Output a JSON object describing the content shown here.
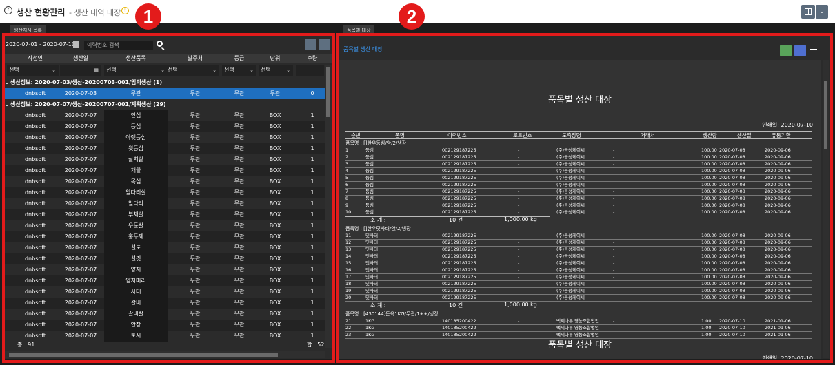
{
  "header": {
    "title": "생산 현황관리",
    "subtitle": "- 생산 내역 대장",
    "back_icon": "back-icon",
    "info_icon": "info-icon"
  },
  "left": {
    "tab": "생산지시 목록",
    "date_range": "2020-07-01 - 2020-07-10",
    "search_placeholder": "이력번호 검색",
    "columns": [
      "작성인",
      "생산일",
      "생산품목",
      "발주처",
      "등급",
      "단위",
      "수량"
    ],
    "filter_select": "선택",
    "groups": [
      {
        "label": "생산정보: 2020-07-03/생산-20200703-001/임의생산 (1)",
        "rows": [
          [
            "dnbsoft",
            "2020-07-03",
            "무관",
            "무관",
            "무관",
            "무관",
            "0"
          ]
        ]
      },
      {
        "label": "생산정보: 2020-07-07/생산-20200707-001/계획생산 (29)",
        "rows": [
          [
            "dnbsoft",
            "2020-07-07",
            "안심",
            "무관",
            "무관",
            "BOX",
            "1"
          ],
          [
            "dnbsoft",
            "2020-07-07",
            "등심",
            "무관",
            "무관",
            "BOX",
            "1"
          ],
          [
            "dnbsoft",
            "2020-07-07",
            "아랫등심",
            "무관",
            "무관",
            "BOX",
            "1"
          ],
          [
            "dnbsoft",
            "2020-07-07",
            "윗등심",
            "무관",
            "무관",
            "BOX",
            "1"
          ],
          [
            "dnbsoft",
            "2020-07-07",
            "살치살",
            "무관",
            "무관",
            "BOX",
            "1"
          ],
          [
            "dnbsoft",
            "2020-07-07",
            "채끝",
            "무관",
            "무관",
            "BOX",
            "1"
          ],
          [
            "dnbsoft",
            "2020-07-07",
            "목심",
            "무관",
            "무관",
            "BOX",
            "1"
          ],
          [
            "dnbsoft",
            "2020-07-07",
            "앞다리살",
            "무관",
            "무관",
            "BOX",
            "1"
          ],
          [
            "dnbsoft",
            "2020-07-07",
            "앞다리",
            "무관",
            "무관",
            "BOX",
            "1"
          ],
          [
            "dnbsoft",
            "2020-07-07",
            "부채살",
            "무관",
            "무관",
            "BOX",
            "1"
          ],
          [
            "dnbsoft",
            "2020-07-07",
            "우둔살",
            "무관",
            "무관",
            "BOX",
            "1"
          ],
          [
            "dnbsoft",
            "2020-07-07",
            "홍두깨",
            "무관",
            "무관",
            "BOX",
            "1"
          ],
          [
            "dnbsoft",
            "2020-07-07",
            "설도",
            "무관",
            "무관",
            "BOX",
            "1"
          ],
          [
            "dnbsoft",
            "2020-07-07",
            "설깃",
            "무관",
            "무관",
            "BOX",
            "1"
          ],
          [
            "dnbsoft",
            "2020-07-07",
            "양지",
            "무관",
            "무관",
            "BOX",
            "1"
          ],
          [
            "dnbsoft",
            "2020-07-07",
            "양지머리",
            "무관",
            "무관",
            "BOX",
            "1"
          ],
          [
            "dnbsoft",
            "2020-07-07",
            "사태",
            "무관",
            "무관",
            "BOX",
            "1"
          ],
          [
            "dnbsoft",
            "2020-07-07",
            "갈비",
            "무관",
            "무관",
            "BOX",
            "1"
          ],
          [
            "dnbsoft",
            "2020-07-07",
            "갈비살",
            "무관",
            "무관",
            "BOX",
            "1"
          ],
          [
            "dnbsoft",
            "2020-07-07",
            "안창",
            "무관",
            "무관",
            "BOX",
            "1"
          ],
          [
            "dnbsoft",
            "2020-07-07",
            "토시",
            "무관",
            "무관",
            "BOX",
            "1"
          ]
        ]
      }
    ],
    "total_label": "총 : 91",
    "sum_label": "합 : 52"
  },
  "right": {
    "tab": "품목별 대장",
    "panel_title": "품목별 생산 대장",
    "report_title": "품목별 생산 대장",
    "print_date": "인쇄일: 2020-07-10",
    "print_date_partial": "인쇄일: 2020-07-10",
    "columns": [
      "순번",
      "품명",
      "이력번호",
      "로트번호",
      "도축장명",
      "거래처",
      "생산량",
      "생산일",
      "유통기한"
    ],
    "sections": [
      {
        "label": "품목명 : []한우등심/암/2/냉장",
        "name": "등심",
        "trace": "002129187225",
        "slaughter": "(주)동성케이씨",
        "qty": "100.00",
        "date": "2020-07-08",
        "expiry": "2020-09-06",
        "start": 1,
        "count": 10
      },
      {
        "label": "품목명 : []한우딧사태/암/2/냉장",
        "name": "딧사태",
        "trace": "002129187225",
        "slaughter": "(주)동성케이씨",
        "qty": "100.00",
        "date": "2020-07-08",
        "expiry": "2020-09-06",
        "start": 11,
        "count": 10
      },
      {
        "label": "품목명 : [430144]돈육1KG/무관/1++/냉장",
        "name": "1KG",
        "trace": "140185200422",
        "slaughter": "백제나루 영농조합법인",
        "qty": "1.00",
        "date": "2020-07-10",
        "expiry": "2021-01-06",
        "start": 21,
        "count": 3
      }
    ],
    "lot_placeholder": "-",
    "client_placeholder": "-",
    "subtotal_label": "소 계 :",
    "subtotal_count": "10 건",
    "subtotal_weight": "1,000.00 kg"
  },
  "annotations": {
    "badge1": "1",
    "badge2": "2"
  },
  "colors": {
    "selected_row": "#1f6fbf",
    "highlight": "#e31b1b",
    "accent": "#3d9fff"
  }
}
